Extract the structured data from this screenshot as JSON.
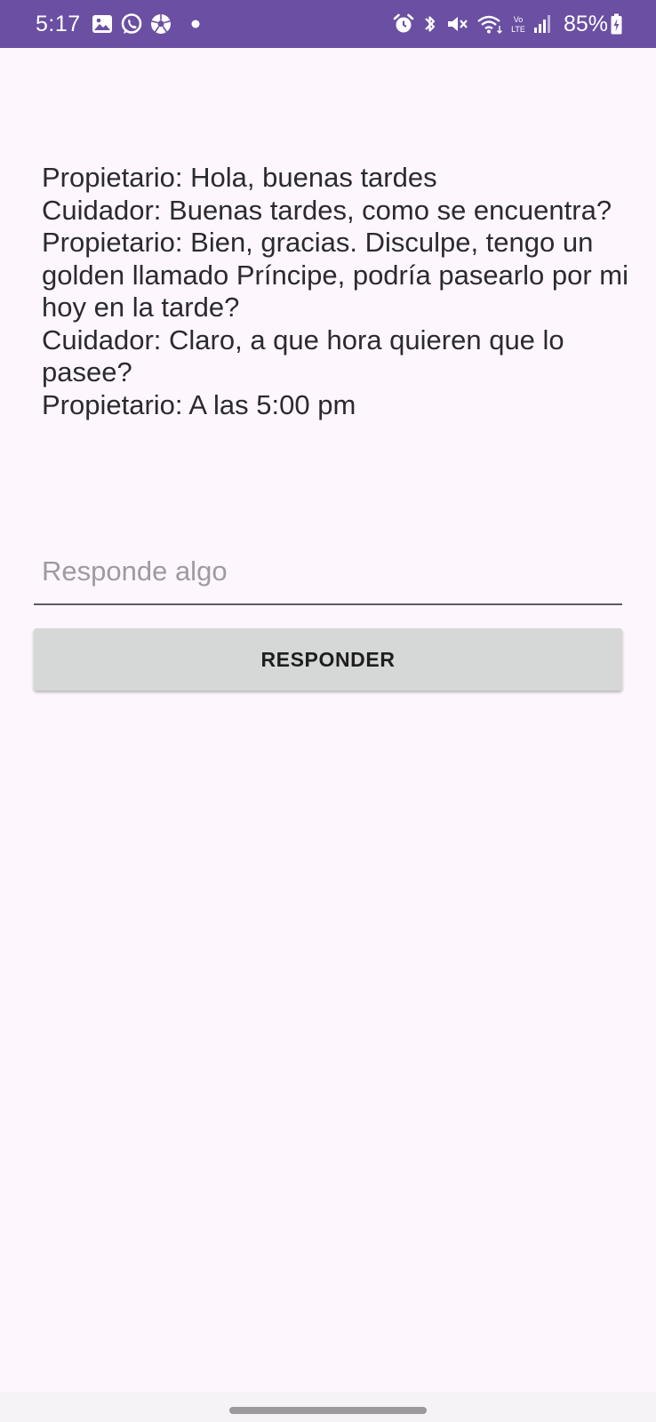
{
  "status_bar": {
    "time": "5:17",
    "battery": "85%",
    "bg_color": "#6a4fa3",
    "left_icons": [
      "gallery-icon",
      "whatsapp-icon",
      "soccer-ball-icon",
      "notification-dot-icon"
    ],
    "right_icons": [
      "alarm-icon",
      "bluetooth-icon",
      "mute-icon",
      "wifi-icon",
      "volte-icon",
      "signal-icon",
      "battery-charging-icon"
    ],
    "volte_label": "Vo LTE"
  },
  "conversation": {
    "text": "Propietario: Hola, buenas tardes\nCuidador: Buenas tardes, como se encuentra?\nPropietario: Bien, gracias. Disculpe, tengo un golden llamado Príncipe, podría pasearlo por mi hoy en la tarde?\nCuidador: Claro, a que hora quieren que lo pasee?\nPropietario: A las 5:00 pm"
  },
  "reply": {
    "placeholder": "Responde algo",
    "value": ""
  },
  "button": {
    "label": "RESPONDER"
  },
  "colors": {
    "background": "#fdf7fd",
    "button_bg": "#d6d7d7",
    "text": "#2c2a2f"
  }
}
